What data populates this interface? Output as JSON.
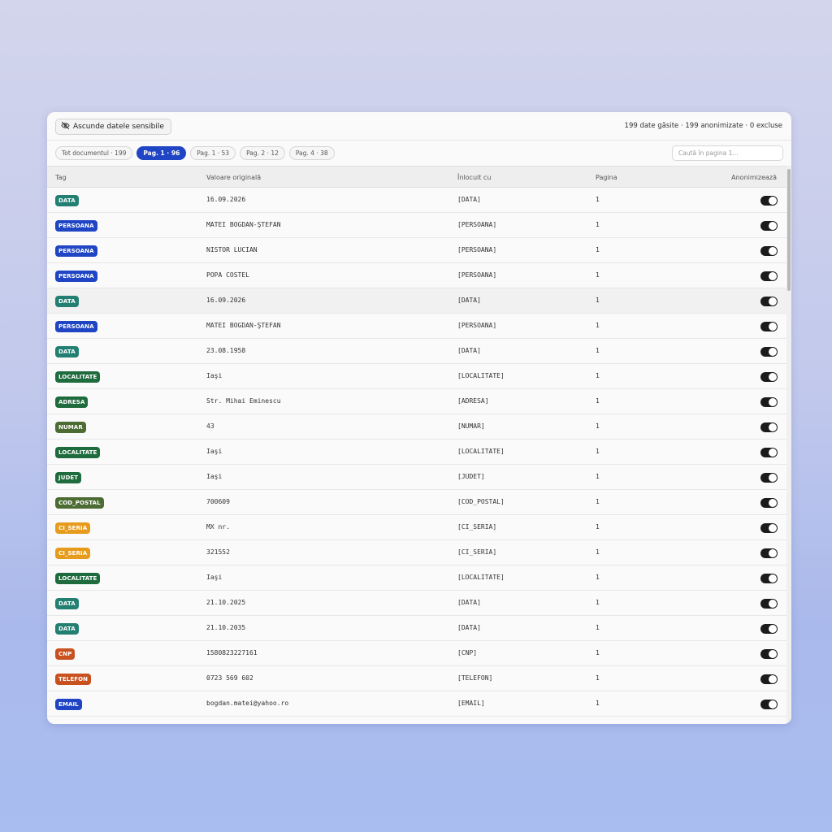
{
  "toolbar": {
    "hide_button_label": "Ascunde datele sensibile",
    "stats_text": "199 date găsite · 199 anonimizate · 0 excluse"
  },
  "filters": {
    "pills": [
      "Tot documentul · 199",
      "Pag. 1 · 96",
      "Pag. 1 · 53",
      "Pag. 2 · 12",
      "Pag. 4 · 38"
    ],
    "active_index": 1,
    "search_placeholder": "Caută în pagina 1..."
  },
  "table": {
    "columns": [
      "Tag",
      "Valoare originală",
      "Înlocuit cu",
      "Pagina",
      "Anonimizează"
    ],
    "rows": [
      {
        "tag": "DATA",
        "tag_color": "#237f72",
        "original": "16.09.2026",
        "replaced": "[DATA]",
        "page": "1",
        "anonymize": true
      },
      {
        "tag": "PERSOANA",
        "tag_color": "#1f45c4",
        "original": "MATEI BOGDAN-ŞTEFAN",
        "replaced": "[PERSOANA]",
        "page": "1",
        "anonymize": true
      },
      {
        "tag": "PERSOANA",
        "tag_color": "#1f45c4",
        "original": "NISTOR LUCIAN",
        "replaced": "[PERSOANA]",
        "page": "1",
        "anonymize": true
      },
      {
        "tag": "PERSOANA",
        "tag_color": "#1f45c4",
        "original": "POPA COSTEL",
        "replaced": "[PERSOANA]",
        "page": "1",
        "anonymize": true
      },
      {
        "tag": "DATA",
        "tag_color": "#237f72",
        "original": "16.09.2026",
        "replaced": "[DATA]",
        "page": "1",
        "anonymize": true
      },
      {
        "tag": "PERSOANA",
        "tag_color": "#1f45c4",
        "original": "MATEI BOGDAN-ŞTEFAN",
        "replaced": "[PERSOANA]",
        "page": "1",
        "anonymize": true
      },
      {
        "tag": "DATA",
        "tag_color": "#237f72",
        "original": "23.08.1958",
        "replaced": "[DATA]",
        "page": "1",
        "anonymize": true
      },
      {
        "tag": "LOCALITATE",
        "tag_color": "#1e6b3d",
        "original": "Iaşi",
        "replaced": "[LOCALITATE]",
        "page": "1",
        "anonymize": true
      },
      {
        "tag": "ADRESA",
        "tag_color": "#1e6b3d",
        "original": "Str. Mihai Eminescu",
        "replaced": "[ADRESA]",
        "page": "1",
        "anonymize": true
      },
      {
        "tag": "NUMAR",
        "tag_color": "#4c6c34",
        "original": "43",
        "replaced": "[NUMAR]",
        "page": "1",
        "anonymize": true
      },
      {
        "tag": "LOCALITATE",
        "tag_color": "#1e6b3d",
        "original": "Iaşi",
        "replaced": "[LOCALITATE]",
        "page": "1",
        "anonymize": true
      },
      {
        "tag": "JUDET",
        "tag_color": "#1e6b3d",
        "original": "Iaşi",
        "replaced": "[JUDET]",
        "page": "1",
        "anonymize": true
      },
      {
        "tag": "COD_POSTAL",
        "tag_color": "#4c6c34",
        "original": "700609",
        "replaced": "[COD_POSTAL]",
        "page": "1",
        "anonymize": true
      },
      {
        "tag": "CI_SERIA",
        "tag_color": "#e79b1d",
        "original": "MX nr.",
        "replaced": "[CI_SERIA]",
        "page": "1",
        "anonymize": true
      },
      {
        "tag": "CI_SERIA",
        "tag_color": "#e79b1d",
        "original": "321552",
        "replaced": "[CI_SERIA]",
        "page": "1",
        "anonymize": true
      },
      {
        "tag": "LOCALITATE",
        "tag_color": "#1e6b3d",
        "original": "Iaşi",
        "replaced": "[LOCALITATE]",
        "page": "1",
        "anonymize": true
      },
      {
        "tag": "DATA",
        "tag_color": "#237f72",
        "original": "21.10.2025",
        "replaced": "[DATA]",
        "page": "1",
        "anonymize": true
      },
      {
        "tag": "DATA",
        "tag_color": "#237f72",
        "original": "21.10.2035",
        "replaced": "[DATA]",
        "page": "1",
        "anonymize": true
      },
      {
        "tag": "CNP",
        "tag_color": "#c9501f",
        "original": "1580823227161",
        "replaced": "[CNP]",
        "page": "1",
        "anonymize": true
      },
      {
        "tag": "TELEFON",
        "tag_color": "#c9501f",
        "original": "0723 569 602",
        "replaced": "[TELEFON]",
        "page": "1",
        "anonymize": true
      },
      {
        "tag": "EMAIL",
        "tag_color": "#1f45c4",
        "original": "bogdan.matei@yahoo.ro",
        "replaced": "[EMAIL]",
        "page": "1",
        "anonymize": true
      },
      {
        "tag": "",
        "tag_color": "#1f45c4",
        "original": "",
        "replaced": "",
        "page": "",
        "anonymize": true
      }
    ]
  },
  "colors": {
    "accent": "#1f45c4",
    "toggle_on": "#1b1b1b"
  },
  "icons": {
    "hide_button": "eye-off-icon"
  }
}
